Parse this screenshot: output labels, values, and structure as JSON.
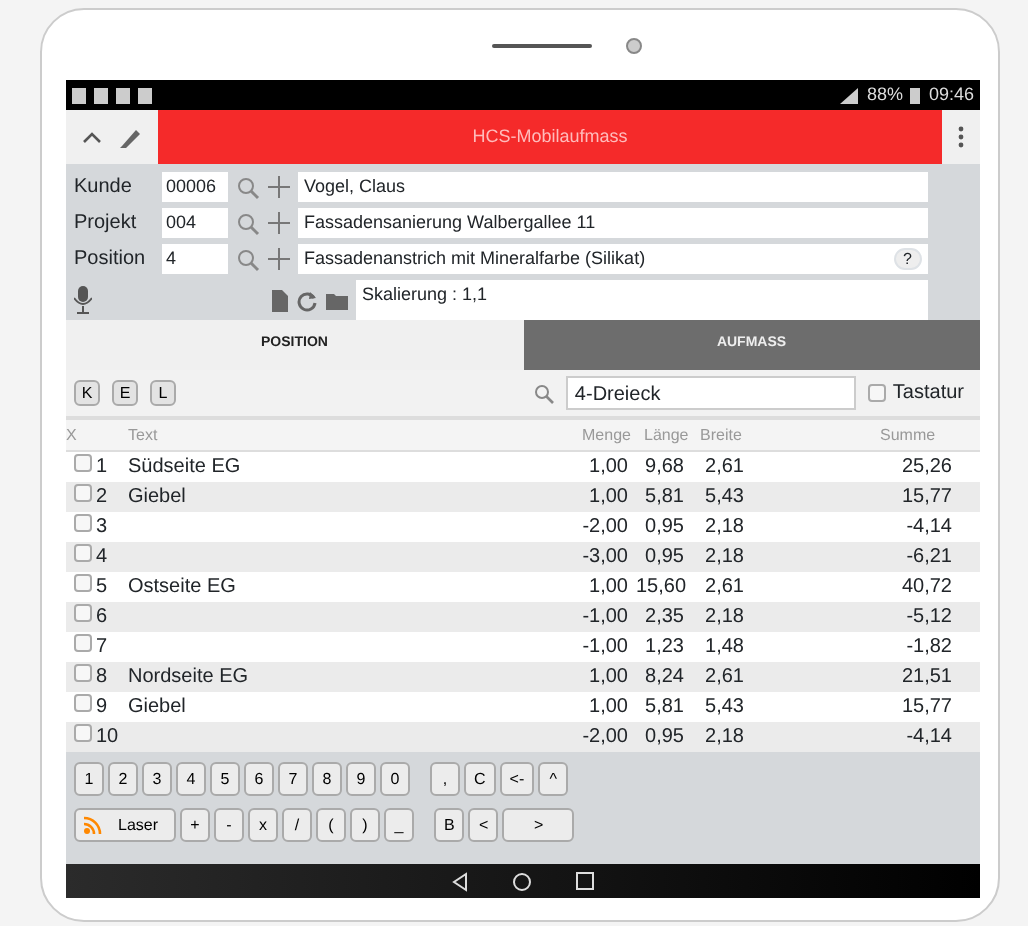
{
  "status_bar": {
    "battery": "88%",
    "time": "09:46"
  },
  "app_bar": {
    "title": "HCS-Mobilaufmass"
  },
  "form": {
    "fields": [
      {
        "label": "Kunde",
        "code": "00006",
        "value": "Vogel, Claus"
      },
      {
        "label": "Projekt",
        "code": "004",
        "value": "Fassadensanierung Walbergallee 11"
      },
      {
        "label": "Position",
        "code": "4",
        "value": "Fassadenanstrich mit Mineralfarbe (Silikat)",
        "help": "?"
      }
    ],
    "scaling": "Skalierung : 1,1"
  },
  "tabs": [
    {
      "label": "POSITION",
      "selected": true
    },
    {
      "label": "AUFMASS",
      "selected": false
    }
  ],
  "toolbar": {
    "letter_buttons": [
      "K",
      "E",
      "L"
    ],
    "search": {
      "value": "4-Dreieck"
    },
    "keyboard": {
      "label": "Tastatur",
      "checked": false
    }
  },
  "table": {
    "columns": [
      "X",
      "Text",
      "Menge",
      "Länge",
      "Breite",
      "Summe"
    ],
    "rows": [
      {
        "checked": false,
        "number": "1",
        "text": "Südseite EG",
        "menge": "1,00",
        "laenge": "9,68",
        "breite": "2,61",
        "summe": "25,26"
      },
      {
        "checked": false,
        "number": "2",
        "text": "Giebel",
        "menge": "1,00",
        "laenge": "5,81",
        "breite": "5,43",
        "summe": "15,77"
      },
      {
        "checked": false,
        "number": "3",
        "menge": "-2,00",
        "laenge": "0,95",
        "breite": "2,18",
        "summe": "-4,14"
      },
      {
        "checked": false,
        "number": "4",
        "menge": "-3,00",
        "laenge": "0,95",
        "breite": "2,18",
        "summe": "-6,21"
      },
      {
        "checked": false,
        "number": "5",
        "text": "Ostseite EG",
        "menge": "1,00",
        "laenge": "15,60",
        "breite": "2,61",
        "summe": "40,72"
      },
      {
        "checked": false,
        "number": "6",
        "menge": "-1,00",
        "laenge": "2,35",
        "breite": "2,18",
        "summe": "-5,12"
      },
      {
        "checked": false,
        "number": "7",
        "menge": "-1,00",
        "laenge": "1,23",
        "breite": "1,48",
        "summe": "-1,82"
      },
      {
        "checked": false,
        "number": "8",
        "text": "Nordseite EG",
        "menge": "1,00",
        "laenge": "8,24",
        "breite": "2,61",
        "summe": "21,51"
      },
      {
        "checked": false,
        "number": "9",
        "text": "Giebel",
        "menge": "1,00",
        "laenge": "5,81",
        "breite": "5,43",
        "summe": "15,77"
      },
      {
        "checked": false,
        "number": "10",
        "menge": "-2,00",
        "laenge": "0,95",
        "breite": "2,18",
        "summe": "-4,14"
      }
    ]
  },
  "keypad": {
    "digit_keys": [
      "1",
      "2",
      "3",
      "4",
      "5",
      "6",
      "7",
      "8",
      "9",
      "0"
    ],
    "edit_keys": [
      ",",
      "C",
      "<-",
      "^"
    ],
    "laser_button": "Laser",
    "operator_keys": [
      "+",
      "-",
      "x",
      "/",
      "(",
      ")",
      "_"
    ],
    "cursor_keys": [
      "B",
      "<",
      ">"
    ]
  }
}
